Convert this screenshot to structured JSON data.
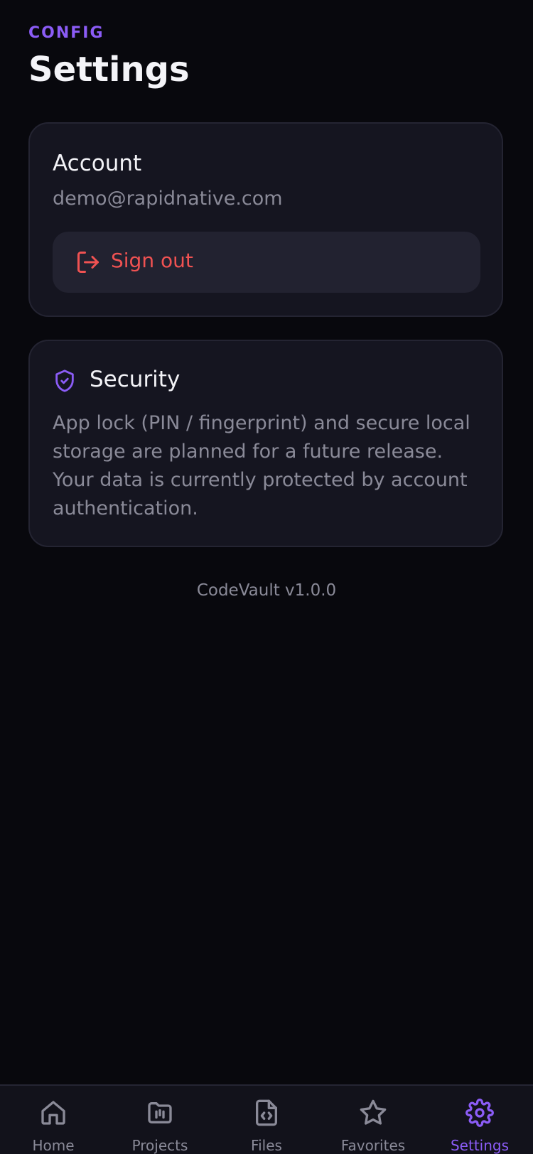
{
  "header": {
    "overline": "CONFIG",
    "title": "Settings"
  },
  "account": {
    "heading": "Account",
    "email": "demo@rapidnative.com",
    "signout_label": "Sign out"
  },
  "security": {
    "heading": "Security",
    "body": "App lock (PIN / fingerprint) and secure local storage are planned for a future release. Your data is currently protected by account authentication."
  },
  "footer": {
    "version": "CodeVault v1.0.0"
  },
  "tabs": [
    {
      "label": "Home",
      "icon": "home-icon",
      "active": false
    },
    {
      "label": "Projects",
      "icon": "folder-icon",
      "active": false
    },
    {
      "label": "Files",
      "icon": "code-file-icon",
      "active": false
    },
    {
      "label": "Favorites",
      "icon": "star-icon",
      "active": false
    },
    {
      "label": "Settings",
      "icon": "gear-icon",
      "active": true
    }
  ],
  "colors": {
    "background": "#08080d",
    "card": "#151520",
    "accent": "#8b5cf6",
    "danger": "#f05252",
    "muted_text": "#8a8a98"
  }
}
